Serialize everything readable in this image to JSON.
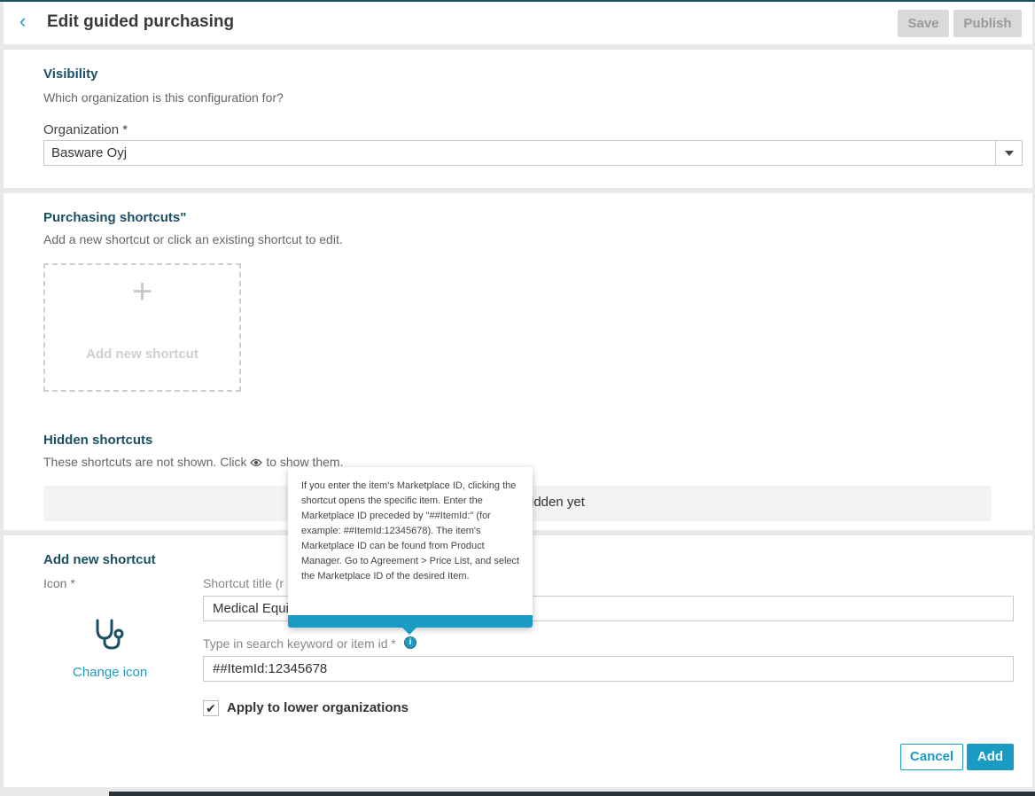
{
  "header": {
    "back_icon": "chevron-left-icon",
    "title": "Edit guided purchasing",
    "save_label": "Save",
    "publish_label": "Publish"
  },
  "visibility": {
    "title": "Visibility",
    "description": "Which organization is this configuration for?",
    "organization_label": "Organization *",
    "organization_value": "Basware Oyj"
  },
  "shortcuts": {
    "title": "Purchasing shortcuts\"",
    "description": "Add a new shortcut or click an existing shortcut to edit.",
    "add_tile_label": "Add new shortcut",
    "hidden_title": "Hidden shortcuts",
    "hidden_desc_before": "These shortcuts are not shown. Click ",
    "hidden_desc_after": " to show them.",
    "hidden_empty": "idden yet"
  },
  "add_new": {
    "title": "Add new shortcut",
    "icon_label": "Icon *",
    "icon_name": "stethoscope-icon",
    "change_icon": "Change icon",
    "shortcut_title_label": "Shortcut title (r",
    "shortcut_title_value": "Medical Equi",
    "search_label": "Type in search keyword or item id *",
    "search_value": "##ItemId:12345678",
    "apply_label": "Apply to lower organizations",
    "apply_checked": true,
    "cancel_label": "Cancel",
    "add_label": "Add"
  },
  "tooltip": {
    "text": "If you enter the item's Marketplace ID, clicking the shortcut opens the specific item. Enter the Marketplace ID preceded by \"##ItemId:\" (for example: ##ItemId:12345678). The item's Marketplace ID can be found from Product Manager. Go to Agreement > Price List, and select the Marketplace ID of the desired Item."
  },
  "colors": {
    "accent": "#1a9bc4",
    "section_title": "#1b4f63"
  }
}
